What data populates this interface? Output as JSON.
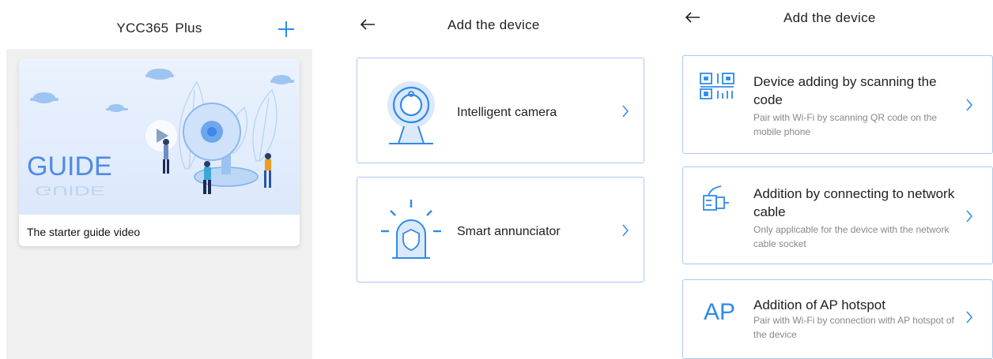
{
  "home": {
    "title": "YCC365  Plus",
    "guide": {
      "art_text": "GUIDE",
      "art_text_reflection": "GUIDE",
      "caption": "The starter guide video"
    }
  },
  "add_device": {
    "title": "Add the device",
    "items": [
      {
        "label": "Intelligent camera",
        "icon": "camera-icon"
      },
      {
        "label": "Smart annunciator",
        "icon": "siren-icon"
      }
    ]
  },
  "add_method": {
    "title": "Add the device",
    "items": [
      {
        "title": "Device adding by scanning the code",
        "desc": "Pair with Wi-Fi by scanning QR code on the mobile phone",
        "icon": "qr-code-icon"
      },
      {
        "title": "Addition by connecting to network cable",
        "desc": "Only applicable for the device with the network cable socket",
        "icon": "ethernet-cable-icon"
      },
      {
        "title": "Addition of AP hotspot",
        "desc": "Pair with Wi-Fi by connection with AP hotspot of the device",
        "icon_text": "AP"
      }
    ]
  },
  "colors": {
    "accent": "#2f8be8",
    "card_border": "#a9c9ee",
    "light_blue": "#dbe9fb"
  }
}
